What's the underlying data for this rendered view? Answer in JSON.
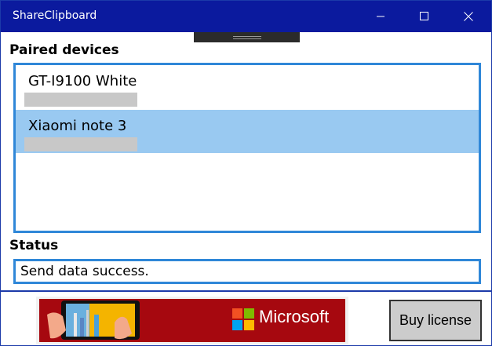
{
  "window": {
    "title": "ShareClipboard",
    "icons": {
      "minimize": "minimize-icon",
      "maximize": "maximize-icon",
      "close": "close-icon"
    }
  },
  "devices": {
    "label": "Paired devices",
    "items": [
      {
        "name": "GT-I9100 White",
        "selected": false
      },
      {
        "name": "Xiaomi note 3",
        "selected": true
      }
    ],
    "accent": "#2f87d8",
    "selection_color": "#99c9f1"
  },
  "status": {
    "label": "Status",
    "value": "Send data success."
  },
  "ad": {
    "brand": "Microsoft",
    "background": "#a6080f"
  },
  "license": {
    "button_label": "Buy license"
  },
  "colors": {
    "titlebar": "#0b1a9e",
    "border": "#2f87d8"
  }
}
